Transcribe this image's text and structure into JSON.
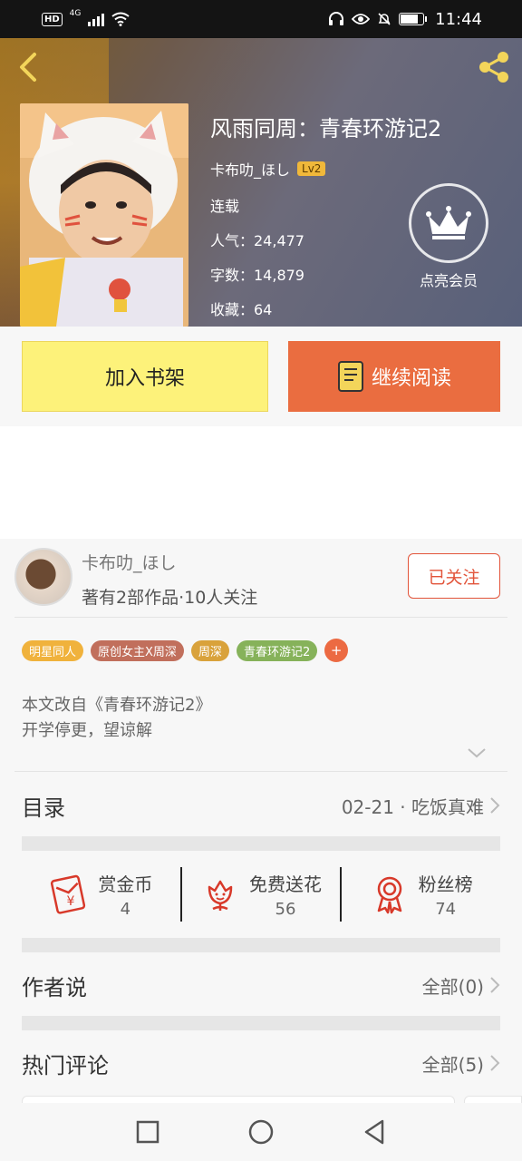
{
  "status_bar": {
    "hd": "HD",
    "network": "4G",
    "time": "11:44",
    "battery_percent": 80
  },
  "header": {
    "back_icon": "chevron-left-icon",
    "share_icon": "share-icon",
    "book_title": "风雨同周：青春环游记2",
    "author": "卡布叻_ほし",
    "level": "Lv2",
    "status": "连载",
    "popularity": "人气：24,477",
    "word_count": "字数：14,879",
    "favorites": "收藏：64",
    "vip_label": "点亮会员",
    "vip_icon": "crown-icon",
    "accent_color": "#f0b83a"
  },
  "actions": {
    "add_shelf": "加入书架",
    "continue_read": "继续阅读",
    "shelf_color": "#fdf27a",
    "read_color": "#ea6d40"
  },
  "author_card": {
    "name": "卡布叻_ほし",
    "stats": "著有2部作品·10人关注",
    "follow_label": "已关注"
  },
  "tags": [
    {
      "label": "明星同人",
      "color": "#f0b23c"
    },
    {
      "label": "原创女主X周深",
      "color": "#c16f5c"
    },
    {
      "label": "周深",
      "color": "#d9a23b"
    },
    {
      "label": "青春环游记2",
      "color": "#86b25a"
    }
  ],
  "tag_more": "+",
  "synopsis": {
    "line1": "本文改自《青春环游记2》",
    "line2": "开学停更，望谅解"
  },
  "catalog": {
    "title": "目录",
    "latest": "02-21 · 吃饭真难"
  },
  "stats": [
    {
      "label": "赏金币",
      "value": "4",
      "icon": "red-envelope-icon"
    },
    {
      "label": "免费送花",
      "value": "56",
      "icon": "flower-icon"
    },
    {
      "label": "粉丝榜",
      "value": "74",
      "icon": "medal-icon"
    }
  ],
  "author_says": {
    "title": "作者说",
    "all": "全部(0)"
  },
  "hot_comments": {
    "title": "热门评论",
    "all": "全部(5)"
  },
  "navbar": {
    "recent_icon": "square-icon",
    "home_icon": "circle-icon",
    "back_icon": "triangle-back-icon"
  }
}
